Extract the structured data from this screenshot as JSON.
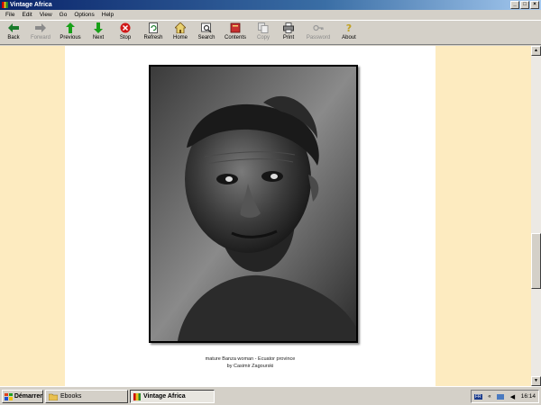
{
  "window": {
    "title": "Vintage Africa"
  },
  "menu": [
    "File",
    "Edit",
    "View",
    "Go",
    "Options",
    "Help"
  ],
  "toolbar": {
    "back": "Back",
    "forward": "Forward",
    "previous": "Previous",
    "next": "Next",
    "stop": "Stop",
    "refresh": "Refresh",
    "home": "Home",
    "search": "Search",
    "contents": "Contents",
    "copy": "Copy",
    "print": "Print",
    "password": "Password",
    "about": "About"
  },
  "caption": {
    "line1": "mature Banza  woman - Ecuator province",
    "line2": "by Casimir Zagourski"
  },
  "taskbar": {
    "start": "Démarrer",
    "task_ebooks": "Ebooks",
    "task_vintage": "Vintage Africa",
    "lang": "FR",
    "clock": "16:14"
  },
  "colors": {
    "page_bg": "#fdebc0",
    "title_bar": "#0a246a"
  }
}
